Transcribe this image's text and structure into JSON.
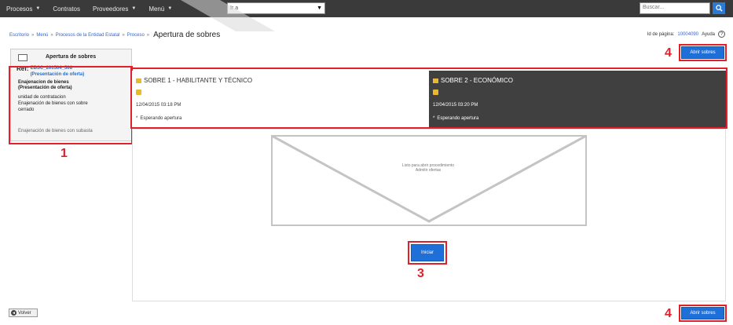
{
  "topnav": {
    "items": [
      {
        "label": "Procesos"
      },
      {
        "label": "Contratos"
      },
      {
        "label": "Proveedores"
      },
      {
        "label": "Menú"
      }
    ],
    "goto_value": "Ir a",
    "search_placeholder": "Buscar..."
  },
  "breadcrumb": {
    "items": [
      "Escritorio",
      "Menú",
      "Procesos de la Entidad Estatal",
      "Proceso"
    ],
    "separator": "»",
    "title": "Apertura de sobres"
  },
  "header_right": {
    "page_id_label": "Id de página:",
    "page_id_value": "10004090",
    "help_label": "Ayuda"
  },
  "buttons": {
    "open_envelopes_label": "Abrir sobres",
    "start_label": "Iniciar",
    "back_label": "Volver"
  },
  "info_panel": {
    "title": "Apertura de sobres",
    "ref_label": "Ref:",
    "ref_code": "EBSC_201504_508",
    "ref_sub": "(Presentación de oferta)",
    "lines": [
      "Enajenacion de bienes",
      "(Presentación de oferta)",
      "unidad de contratacion",
      "Enajenación de bienes con sobre",
      "cerrado",
      "Enajenación de bienes con subasta"
    ]
  },
  "envelopes": [
    {
      "title": "SOBRE 1 - HABILITANTE Y TÉCNICO",
      "date": "12/04/2015 03:18 PM",
      "status": "Esperando apertura"
    },
    {
      "title": "SOBRE 2 - ECONÓMICO",
      "date": "12/04/2015 03:20 PM",
      "status": "Esperando apertura"
    }
  ],
  "main": {
    "ready_line1": "Listo para abrir procedimiento",
    "ready_line2": "Admitir ofertas"
  },
  "markers": [
    "1",
    "2",
    "3",
    "4",
    "4"
  ],
  "colors": {
    "topbar": "#3a3a3a",
    "accent_blue": "#1f6fd9",
    "highlight_red": "#e0202a",
    "dark_card": "#404040",
    "lock_yellow": "#e8b830"
  }
}
